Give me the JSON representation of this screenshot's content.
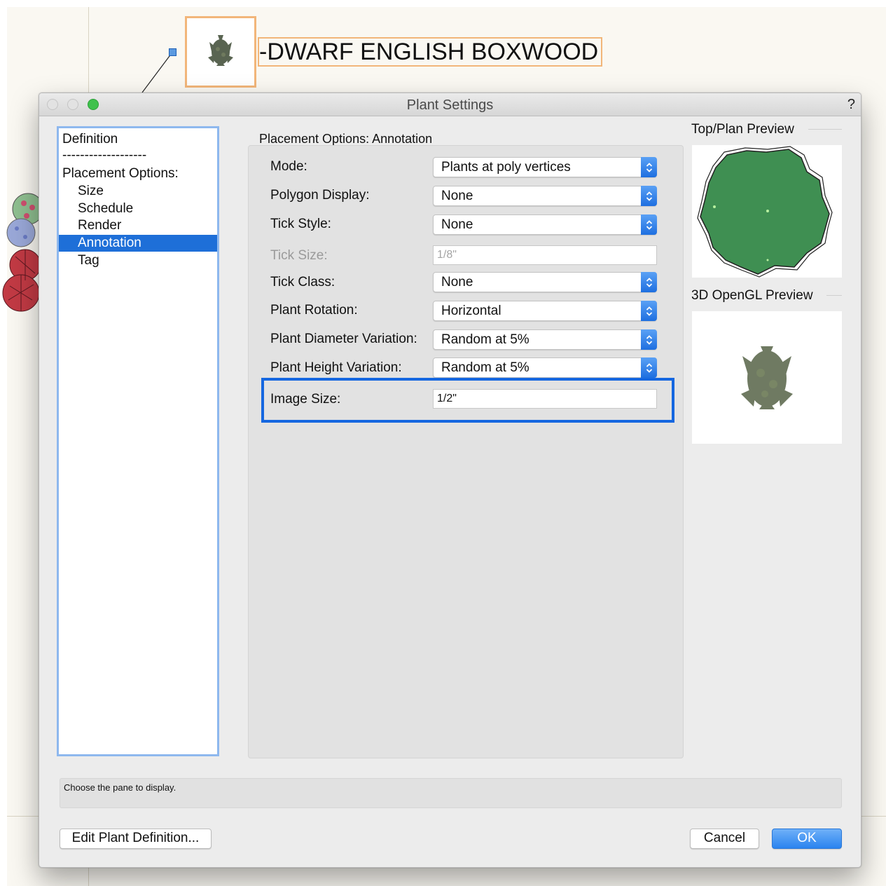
{
  "drawing": {
    "tag_text": "-DWARF ENGLISH BOXWOOD"
  },
  "window": {
    "title": "Plant Settings",
    "help": "?"
  },
  "pane_list": {
    "items": [
      {
        "label": "Definition"
      },
      {
        "label": "-------------------"
      },
      {
        "label": "Placement Options:"
      },
      {
        "label": "Size"
      },
      {
        "label": "Schedule"
      },
      {
        "label": "Render"
      },
      {
        "label": "Annotation",
        "selected": true
      },
      {
        "label": "Tag"
      }
    ]
  },
  "section": {
    "title": "Placement Options: Annotation"
  },
  "fields": [
    {
      "label": "Mode:",
      "type": "popup",
      "value": "Plants at poly vertices"
    },
    {
      "label": "Polygon Display:",
      "type": "popup",
      "value": "None"
    },
    {
      "label": "Tick Style:",
      "type": "popup",
      "value": "None"
    },
    {
      "label": "Tick Size:",
      "type": "text",
      "value": "1/8\"",
      "disabled": true
    },
    {
      "label": "Tick Class:",
      "type": "popup",
      "value": "None"
    },
    {
      "label": "Plant Rotation:",
      "type": "popup",
      "value": "Horizontal"
    },
    {
      "label": "Plant Diameter Variation:",
      "type": "popup",
      "value": "Random at 5%"
    },
    {
      "label": "Plant Height Variation:",
      "type": "popup",
      "value": "Random at 5%"
    },
    {
      "label": "Image Size:",
      "type": "text",
      "value": "1/2\"",
      "highlighted": true
    }
  ],
  "previews": {
    "top_plan_label": "Top/Plan Preview",
    "opengl_label": "3D OpenGL Preview",
    "plan_fill_color": "#3f8f52"
  },
  "status": {
    "text": "Choose the pane to display."
  },
  "buttons": {
    "edit_definition": "Edit Plant Definition...",
    "cancel": "Cancel",
    "ok": "OK"
  },
  "colors": {
    "accent": "#1e6fd8",
    "highlight_border": "#1567e0",
    "tag_border": "#f2b67a"
  }
}
